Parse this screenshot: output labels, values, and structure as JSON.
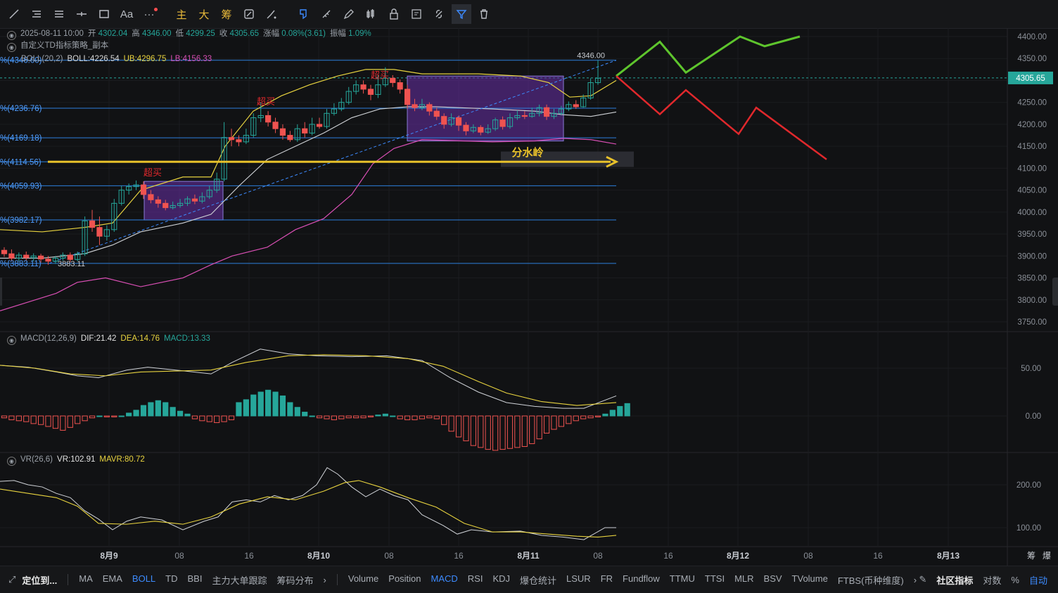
{
  "toolbar": {
    "items": [
      "line-tool",
      "hline-tool",
      "channel-tool",
      "crosshair-tool",
      "rect-tool",
      "text-tool",
      "more-tool"
    ],
    "text_label": "Aa",
    "text_buttons": [
      "主",
      "大",
      "筹"
    ]
  },
  "info": {
    "datetime": "2025-08-11 10:00",
    "open_label": "开",
    "open": "4302.04",
    "high_label": "高",
    "high": "4346.00",
    "low_label": "低",
    "low": "4299.25",
    "close_label": "收",
    "close": "4305.65",
    "change_label": "涨幅",
    "change": "0.08%(3.61)",
    "amp_label": "振幅",
    "amp": "1.09%",
    "strategy": "自定义TD指标策略_副本",
    "boll_name": "BOLL(20,2)",
    "boll_mid": "BOLL:4226.54",
    "boll_ub": "UB:4296.75",
    "boll_lb": "LB:4156.33"
  },
  "macd_info": {
    "name": "MACD(12,26,9)",
    "dif": "DIF:21.42",
    "dea": "DEA:14.76",
    "macd": "MACD:13.33"
  },
  "vr_info": {
    "name": "VR(26,6)",
    "vr": "VR:102.91",
    "mavr": "MAVR:80.72"
  },
  "price_axis": [
    "4400.00",
    "4350.00",
    "4300.00",
    "4250.00",
    "4200.00",
    "4150.00",
    "4100.00",
    "4050.00",
    "4000.00",
    "3950.00",
    "3900.00",
    "3850.00",
    "3800.00",
    "3750.00"
  ],
  "current_price": "4305.65",
  "macd_axis": [
    "50.00",
    "0.00"
  ],
  "vr_axis": [
    "200.00",
    "100.00"
  ],
  "time_axis": [
    "8月9",
    "08",
    "16",
    "8月10",
    "08",
    "16",
    "8月11",
    "08",
    "16",
    "8月12",
    "08",
    "16",
    "8月13"
  ],
  "corner_labels": [
    "筹",
    "爆"
  ],
  "fib_levels": [
    "%(4346.00)",
    "%(4236.76)",
    "%(4169.18)",
    "%(4114.56)",
    "%(4059.93)",
    "%(3982.17)",
    "%(3883.11)"
  ],
  "fib_values": [
    4346.0,
    4236.76,
    4169.18,
    4114.56,
    4059.93,
    3982.17,
    3883.11
  ],
  "high_marker": "4346.00",
  "low_marker": "3883.11",
  "annotations": {
    "overbought": "超买",
    "watershed": "分水岭"
  },
  "colors": {
    "up": "#26a69a",
    "down": "#ef5350",
    "mid": "#cfd2d6",
    "ub": "#e8d33f",
    "lb": "#d94fb4",
    "fib": "#2d7fdc",
    "watershed": "#e8c12a",
    "box": "#6a2fa8",
    "bull_path": "#5ec52d",
    "bear_path": "#e0282c"
  },
  "bottom": {
    "locate": "定位到...",
    "main_indicators": [
      "MA",
      "EMA",
      "BOLL",
      "TD",
      "BBI",
      "主力大单跟踪",
      "筹码分布"
    ],
    "active_main": "BOLL",
    "sub_indicators": [
      "Volume",
      "Position",
      "MACD",
      "RSI",
      "KDJ",
      "爆仓统计",
      "LSUR",
      "FR",
      "Fundflow",
      "TTMU",
      "TTSI",
      "MLR",
      "BSV",
      "TVolume",
      "FTBS(币种维度)"
    ],
    "active_sub": "MACD",
    "community": "社区指标",
    "log": "对数",
    "percent": "%",
    "auto": "自动"
  }
}
